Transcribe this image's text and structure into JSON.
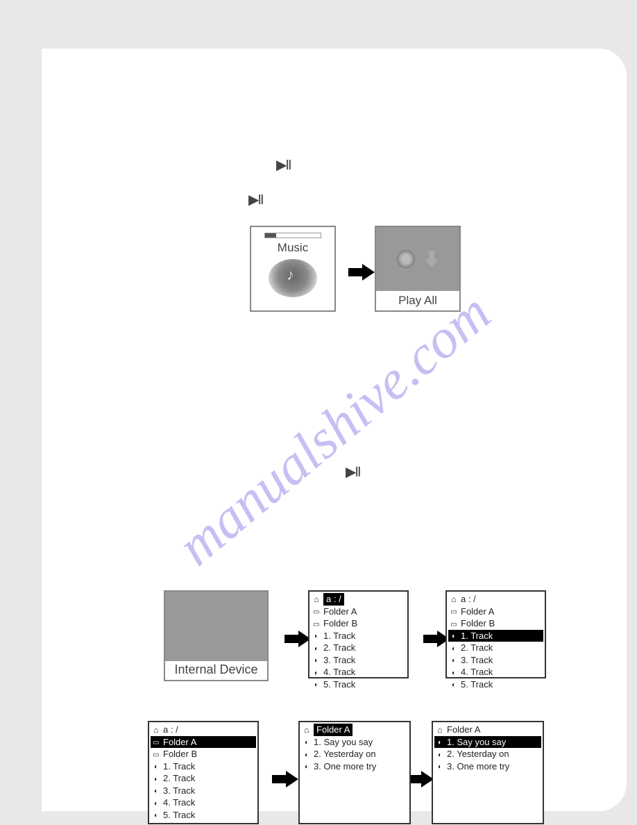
{
  "watermark": "manualshive.com",
  "icons": {
    "playpause": "▶II"
  },
  "music": {
    "label": "Music"
  },
  "playall": {
    "label": "Play All"
  },
  "internal": {
    "label": "Internal Device"
  },
  "panel1": {
    "header": "a : /",
    "items": [
      {
        "icon": "folder",
        "label": "Folder A",
        "selected": false
      },
      {
        "icon": "folder",
        "label": "Folder B",
        "selected": false
      },
      {
        "icon": "file",
        "label": "1. Track",
        "selected": false
      },
      {
        "icon": "file",
        "label": "2. Track",
        "selected": false
      },
      {
        "icon": "file",
        "label": "3. Track",
        "selected": false
      },
      {
        "icon": "file",
        "label": "4. Track",
        "selected": false
      },
      {
        "icon": "file",
        "label": "5. Track",
        "selected": false
      }
    ],
    "headerSelected": true
  },
  "panel2": {
    "header": "a : /",
    "items": [
      {
        "icon": "folder",
        "label": "Folder A",
        "selected": false
      },
      {
        "icon": "folder",
        "label": "Folder B",
        "selected": false
      },
      {
        "icon": "file",
        "label": "1. Track",
        "selected": true
      },
      {
        "icon": "file",
        "label": "2. Track",
        "selected": false
      },
      {
        "icon": "file",
        "label": "3. Track",
        "selected": false
      },
      {
        "icon": "file",
        "label": "4. Track",
        "selected": false
      },
      {
        "icon": "file",
        "label": "5. Track",
        "selected": false
      }
    ],
    "headerSelected": false
  },
  "panel3": {
    "header": "a : /",
    "items": [
      {
        "icon": "folder",
        "label": "Folder A",
        "selected": true
      },
      {
        "icon": "folder",
        "label": "Folder B",
        "selected": false
      },
      {
        "icon": "file",
        "label": "1. Track",
        "selected": false
      },
      {
        "icon": "file",
        "label": "2. Track",
        "selected": false
      },
      {
        "icon": "file",
        "label": "3. Track",
        "selected": false
      },
      {
        "icon": "file",
        "label": "4. Track",
        "selected": false
      },
      {
        "icon": "file",
        "label": "5. Track",
        "selected": false
      }
    ],
    "headerSelected": false
  },
  "panel4": {
    "header": "Folder A",
    "items": [
      {
        "icon": "file",
        "label": "1. Say you say",
        "selected": false
      },
      {
        "icon": "file",
        "label": "2. Yesterday on",
        "selected": false
      },
      {
        "icon": "file",
        "label": "3. One more try",
        "selected": false
      }
    ],
    "headerSelected": true
  },
  "panel5": {
    "header": "Folder A",
    "items": [
      {
        "icon": "file",
        "label": "1. Say you say",
        "selected": true
      },
      {
        "icon": "file",
        "label": "2. Yesterday on",
        "selected": false
      },
      {
        "icon": "file",
        "label": "3. One more try",
        "selected": false
      }
    ],
    "headerSelected": false
  }
}
